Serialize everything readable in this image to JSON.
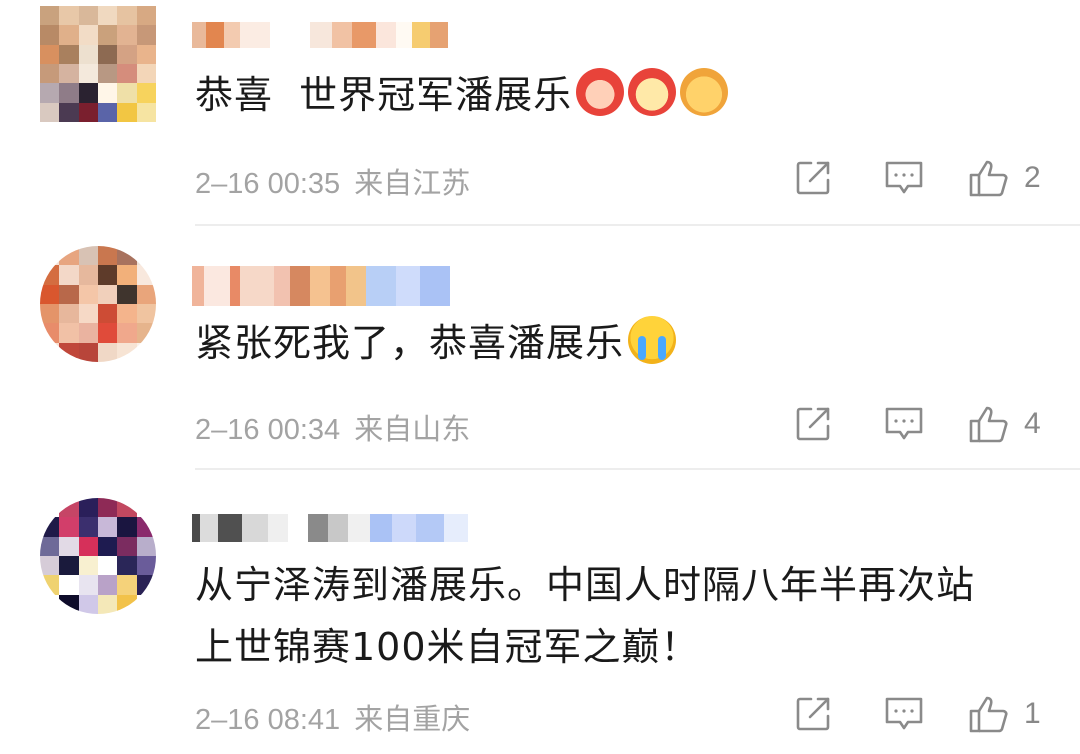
{
  "comments": [
    {
      "text": "恭喜  世界冠军潘展乐",
      "emojis": [
        "dragon-fu",
        "lion-dance",
        "dragon"
      ],
      "time": "2–16 00:35",
      "location": "来自江苏",
      "likes": "2"
    },
    {
      "text": "紧张死我了，恭喜潘展乐",
      "emojis": [
        "crying-face"
      ],
      "time": "2–16 00:34",
      "location": "来自山东",
      "likes": "4"
    },
    {
      "text_line1": "从宁泽涛到潘展乐。中国人时隔八年半再次站",
      "text_line2": "上世锦赛100米自冠军之巅！",
      "time": "2–16 08:41",
      "location": "来自重庆",
      "likes": "1"
    }
  ],
  "colors": {
    "text": "#1a1a1a",
    "meta": "#a3a3a3",
    "icon": "#8a8a8a",
    "divider": "#ededed"
  }
}
